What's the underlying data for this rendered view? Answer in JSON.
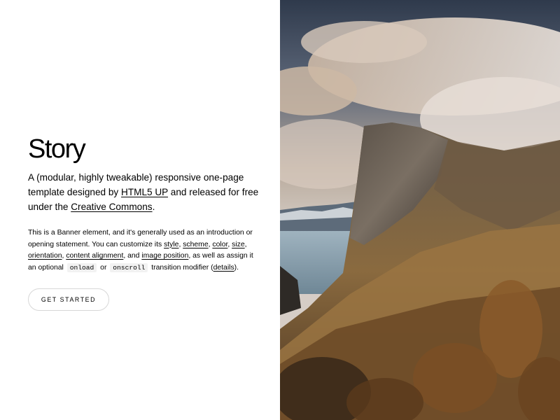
{
  "banner": {
    "title": "Story",
    "lead": {
      "text_1": "A (modular, highly tweakable) responsive one-page template designed by ",
      "link_1": "HTML5 UP",
      "text_2": " and released for free under the ",
      "link_2": "Creative Commons",
      "text_3": "."
    },
    "body": {
      "t1": "This is a Banner element, and it's generally used as an introduction or opening statement. You can customize its ",
      "l_style": "style",
      "s1": ", ",
      "l_scheme": "scheme",
      "s2": ", ",
      "l_color": "color",
      "s3": ", ",
      "l_size": "size",
      "s4": ", ",
      "l_orientation": "orientation",
      "s5": ", ",
      "l_content_alignment": "content alignment",
      "s6": ", and ",
      "l_image_position": "image position",
      "s7": ", as well as assign it an optional ",
      "code_onload": "onload",
      "s8": " or ",
      "code_onscroll": "onscroll",
      "s9": " transition modifier (",
      "l_details": "details",
      "s10": ")."
    },
    "cta_label": "GET STARTED"
  },
  "image": {
    "description_icon": "mountain-landscape-photo"
  }
}
